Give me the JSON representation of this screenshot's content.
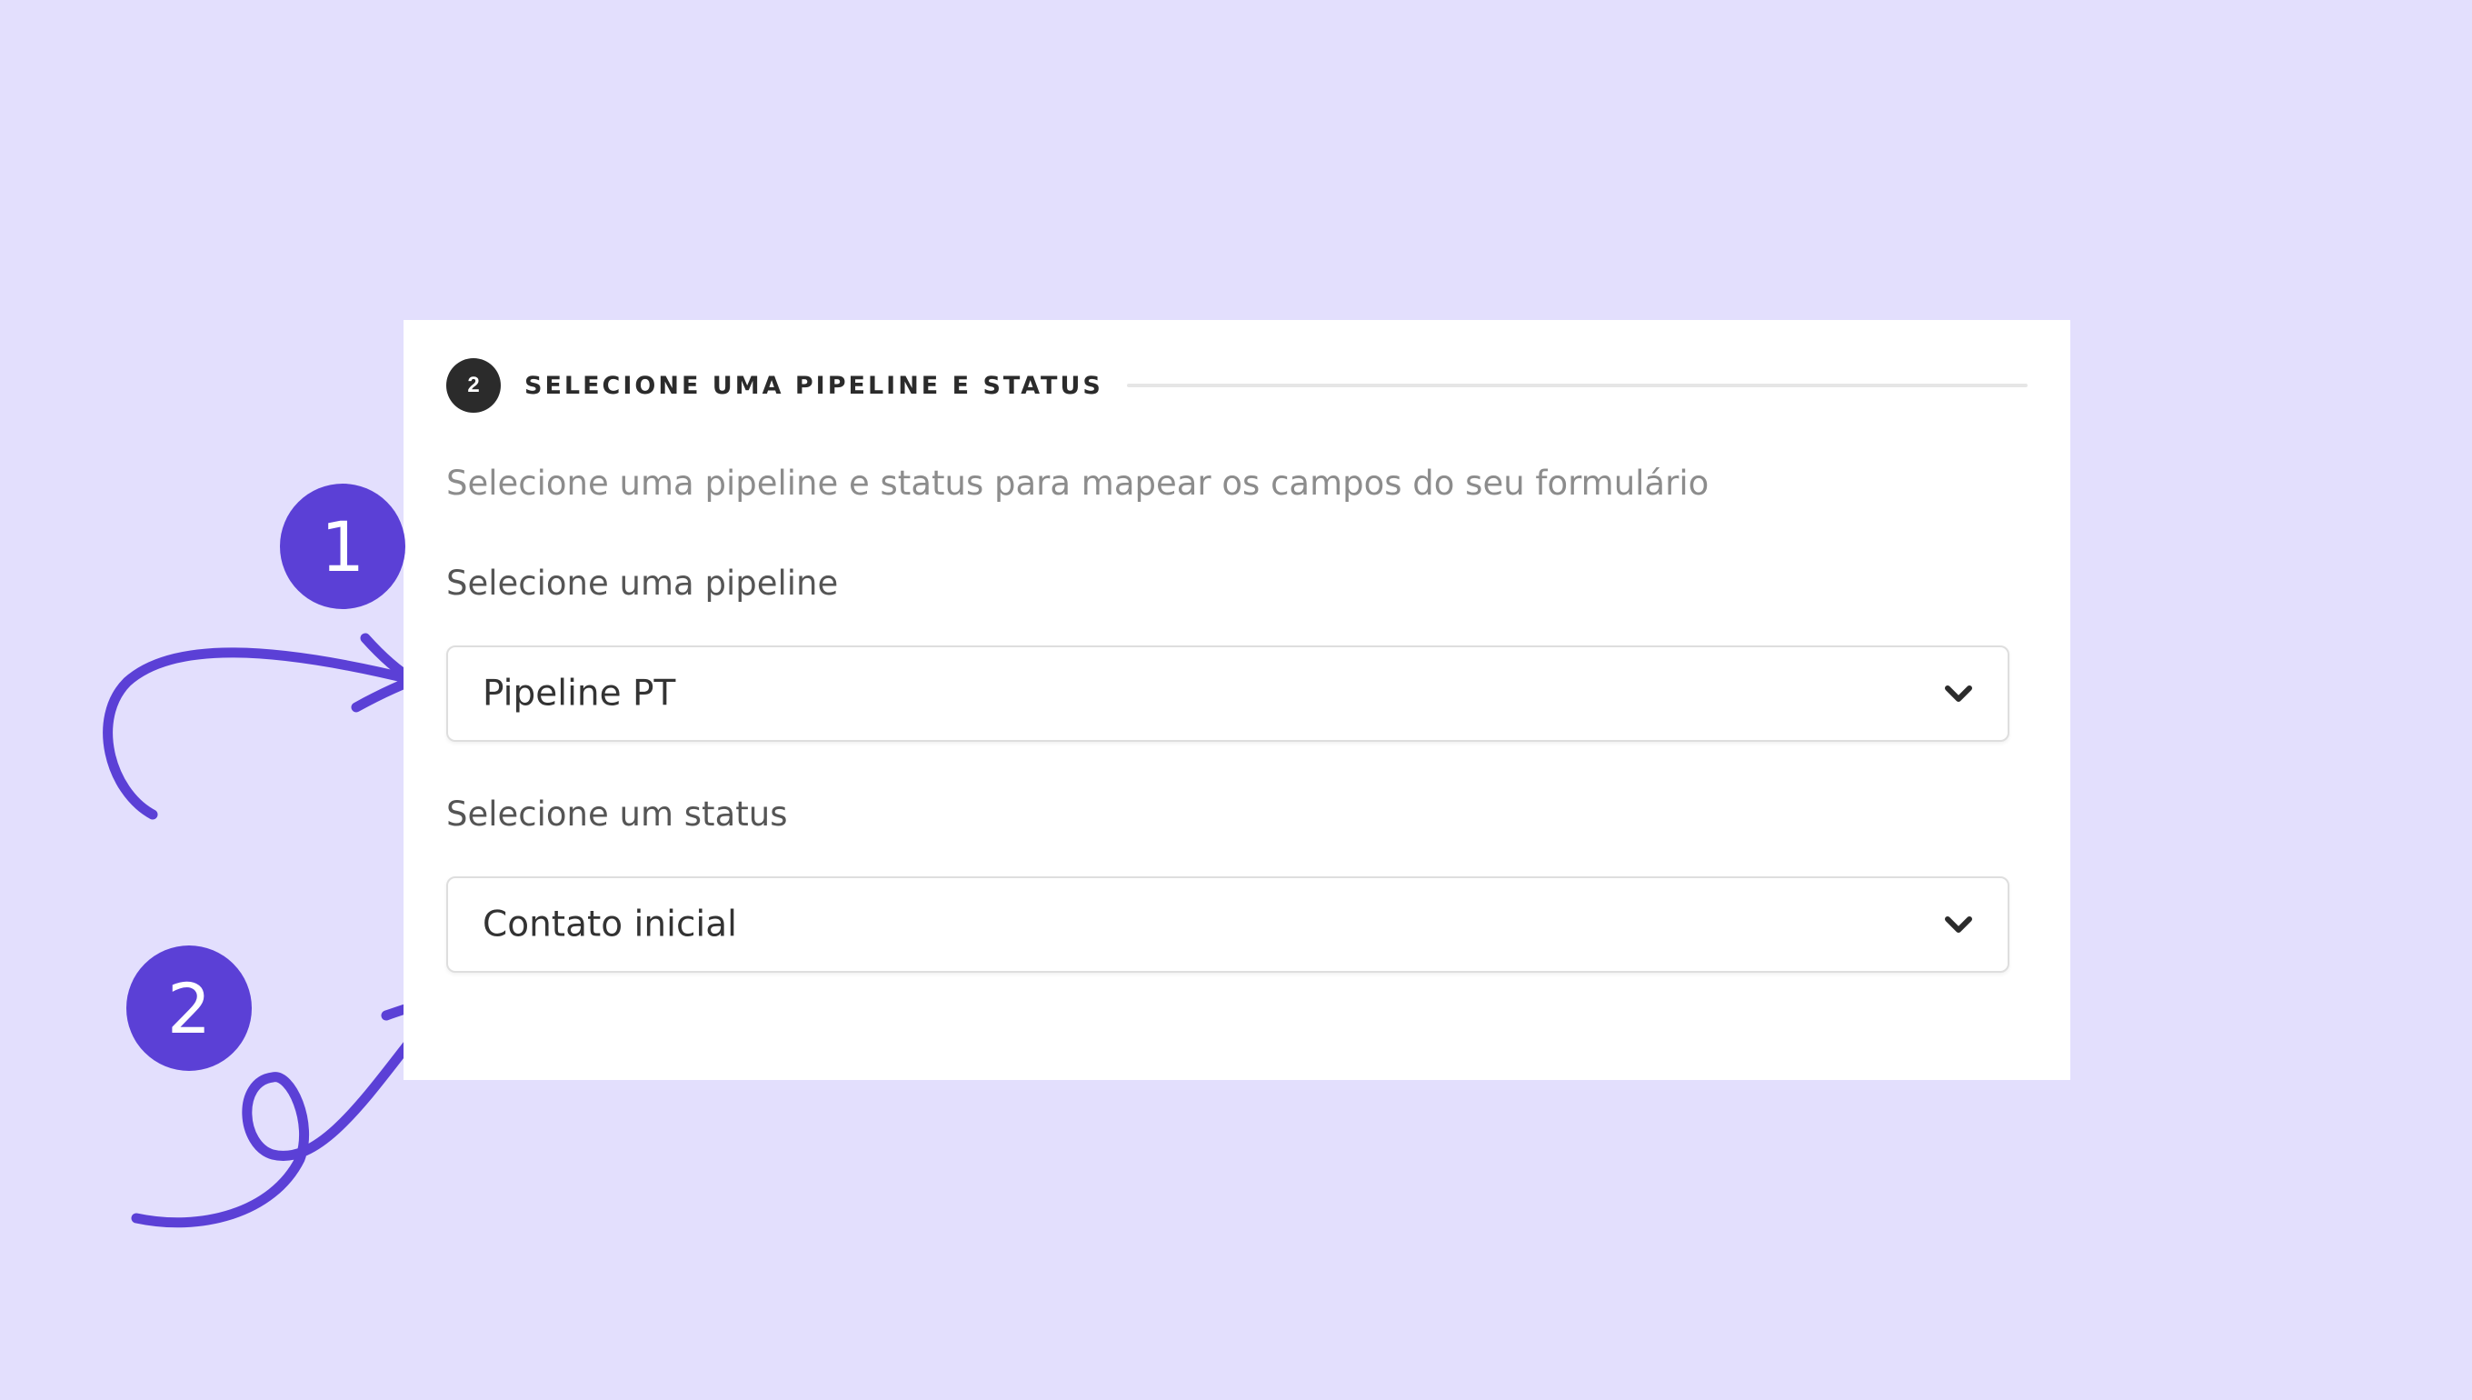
{
  "section": {
    "step_number": "2",
    "title": "SELECIONE UMA PIPELINE E STATUS",
    "description": "Selecione uma pipeline e status para mapear os campos do seu formulário"
  },
  "pipeline_field": {
    "label": "Selecione uma pipeline",
    "selected_value": "Pipeline PT",
    "icon": "chevron-down-icon"
  },
  "status_field": {
    "label": "Selecione um status",
    "selected_value": "Contato inicial",
    "icon": "chevron-down-icon"
  },
  "annotations": {
    "badge_one": "1",
    "badge_two": "2",
    "accent_color": "#5b40d6",
    "background_color": "#e3dffd"
  }
}
